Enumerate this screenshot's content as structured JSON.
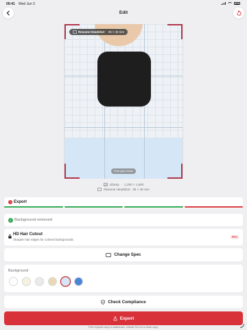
{
  "status_bar": {
    "time": "09:41",
    "date": "Wed Jun 3"
  },
  "nav": {
    "title": "Edit",
    "back_icon": "chevron-left-icon",
    "reset_icon": "reset-icon"
  },
  "preview": {
    "spec_label": "Resume Headshot",
    "spec_size": "35 × 45 mm",
    "frame_label": "Final spec frame"
  },
  "meta": {
    "source": "Library",
    "dimensions": "1,200 × 1,600",
    "spec": "Resume Headshot · 35 × 45 mm"
  },
  "export_status": {
    "label": "Export",
    "bars": [
      "#34a853",
      "#34a853",
      "#34a853",
      "#d83a3f"
    ]
  },
  "background_removed": {
    "label": "Background removed"
  },
  "hd_hair": {
    "title": "HD Hair Cutout",
    "description": "Sharper hair edges for colored backgrounds.",
    "badge": "PRO"
  },
  "change_spec": {
    "label": "Change Spec"
  },
  "background": {
    "title": "Background",
    "swatches": [
      {
        "color": "#ffffff",
        "selected": false
      },
      {
        "color": "#f7f2df",
        "selected": false
      },
      {
        "color": "#ebebeb",
        "selected": false
      },
      {
        "color": "#e9d8b5",
        "selected": false
      },
      {
        "color": "#d5e6f6",
        "selected": true
      },
      {
        "color": "#4a86d8",
        "selected": false
      }
    ]
  },
  "check_compliance": {
    "label": "Check Compliance"
  },
  "export_button": {
    "label": "Export"
  },
  "footnote": "Free exports carry a watermark. Unlock Pro for a clean copy.",
  "colors": {
    "accent": "#d8313a",
    "success": "#34a853",
    "frame": "#b0364a"
  }
}
